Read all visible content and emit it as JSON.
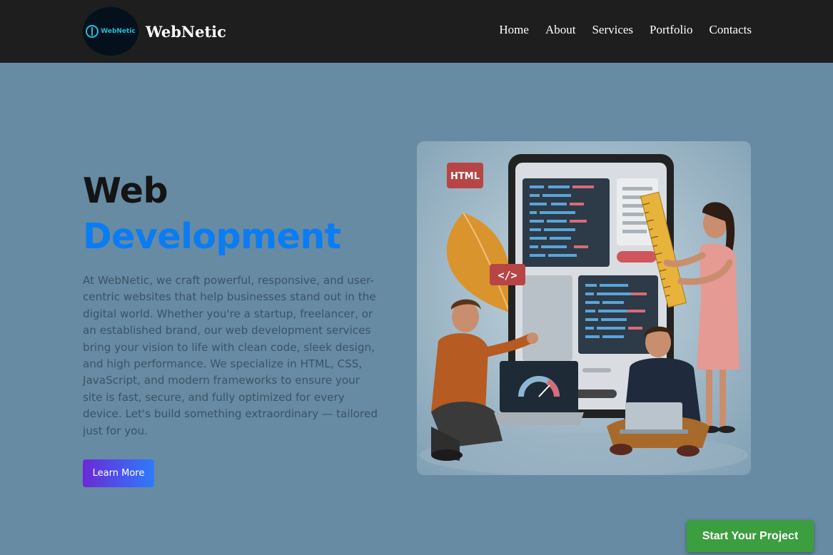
{
  "header": {
    "logo_text": "WebNetic",
    "brand_name": "WebNetic",
    "nav": [
      "Home",
      "About",
      "Services",
      "Portfolio",
      "Contacts"
    ]
  },
  "hero": {
    "title_line1": "Web",
    "title_line2": "Development",
    "description": "At WebNetic, we craft powerful, responsive, and user-centric websites that help businesses stand out in the digital world. Whether you're a startup, freelancer, or an established brand, our web development services bring your vision to life with clean code, sleek design, and high performance. We specialize in HTML, CSS, JavaScript, and modern frameworks to ensure your site is fast, secure, and fully optimized for every device. Let's build something extraordinary — tailored just for you.",
    "button_label": "Learn More"
  },
  "illustration": {
    "html_tag": "HTML",
    "code_tag": "</>"
  },
  "cta": {
    "label": "Start Your Project"
  },
  "colors": {
    "page_bg": "#668ba3",
    "topbar_bg": "#1e1e1e",
    "accent_blue": "#0a7cf4",
    "cta_green": "#3b9e3f"
  }
}
